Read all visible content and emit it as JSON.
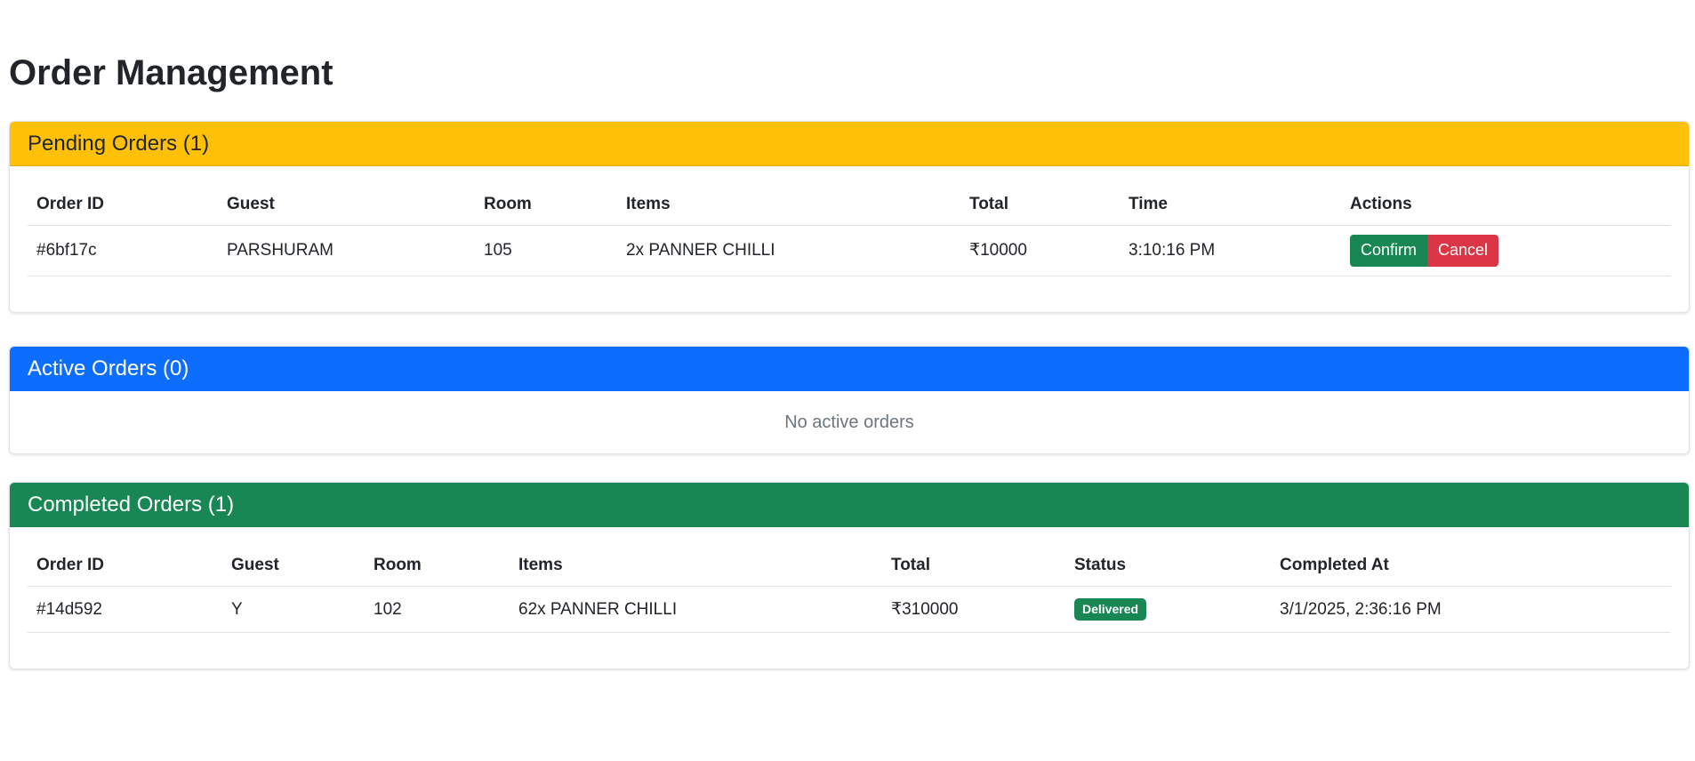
{
  "page": {
    "title": "Order Management"
  },
  "pending": {
    "title": "Pending Orders (1)",
    "columns": [
      "Order ID",
      "Guest",
      "Room",
      "Items",
      "Total",
      "Time",
      "Actions"
    ],
    "rows": [
      {
        "order_id": "#6bf17c",
        "guest": "PARSHURAM",
        "room": "105",
        "items": "2x PANNER CHILLI",
        "total": "₹10000",
        "time": "3:10:16 PM",
        "confirm_label": "Confirm",
        "cancel_label": "Cancel"
      }
    ]
  },
  "active": {
    "title": "Active Orders (0)",
    "empty_message": "No active orders"
  },
  "completed": {
    "title": "Completed Orders (1)",
    "columns": [
      "Order ID",
      "Guest",
      "Room",
      "Items",
      "Total",
      "Status",
      "Completed At"
    ],
    "rows": [
      {
        "order_id": "#14d592",
        "guest": "Y",
        "room": "102",
        "items": "62x PANNER CHILLI",
        "total": "₹310000",
        "status": "Delivered",
        "completed_at": "3/1/2025, 2:36:16 PM"
      }
    ]
  },
  "colors": {
    "pending_header": "#ffc107",
    "active_header": "#0d6efd",
    "completed_header": "#198754",
    "confirm_button": "#198754",
    "cancel_button": "#dc3545",
    "status_badge": "#198754"
  }
}
